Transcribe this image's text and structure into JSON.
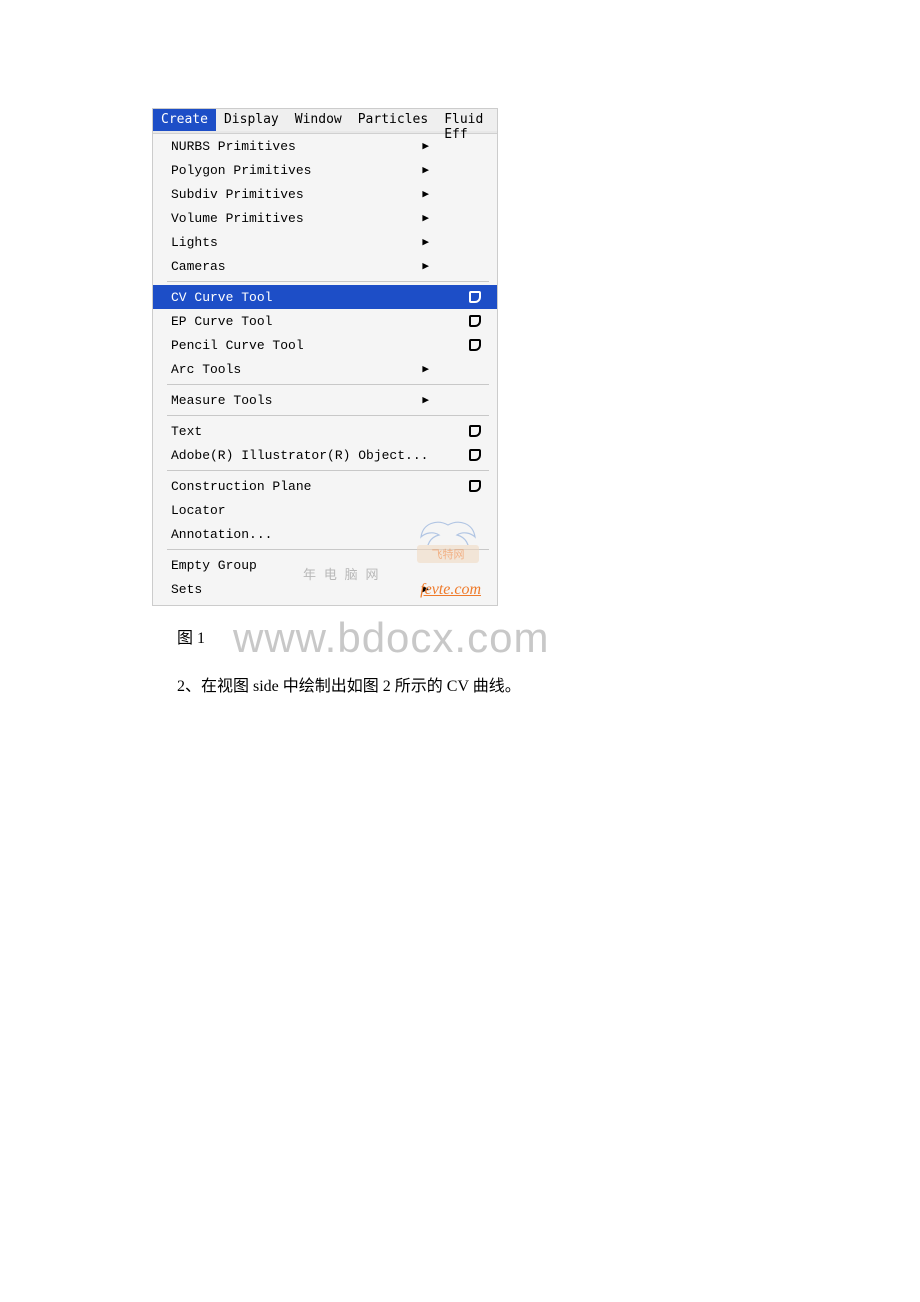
{
  "menubar": {
    "items": [
      "Create",
      "Display",
      "Window",
      "Particles",
      "Fluid Eff"
    ],
    "activeIndex": 0
  },
  "menuGroups": [
    [
      {
        "label": "NURBS Primitives",
        "submenu": true,
        "options": false
      },
      {
        "label": "Polygon Primitives",
        "submenu": true,
        "options": false
      },
      {
        "label": "Subdiv Primitives",
        "submenu": true,
        "options": false
      },
      {
        "label": "Volume Primitives",
        "submenu": true,
        "options": false
      },
      {
        "label": "Lights",
        "submenu": true,
        "options": false
      },
      {
        "label": "Cameras",
        "submenu": true,
        "options": false
      }
    ],
    [
      {
        "label": "CV Curve Tool",
        "submenu": false,
        "options": true,
        "highlighted": true
      },
      {
        "label": "EP Curve Tool",
        "submenu": false,
        "options": true
      },
      {
        "label": "Pencil Curve Tool",
        "submenu": false,
        "options": true
      },
      {
        "label": "Arc Tools",
        "submenu": true,
        "options": false
      }
    ],
    [
      {
        "label": "Measure Tools",
        "submenu": true,
        "options": false
      }
    ],
    [
      {
        "label": "Text",
        "submenu": false,
        "options": true
      },
      {
        "label": "Adobe(R) Illustrator(R) Object...",
        "submenu": false,
        "options": true
      }
    ],
    [
      {
        "label": "Construction Plane",
        "submenu": false,
        "options": true
      },
      {
        "label": "Locator",
        "submenu": false,
        "options": false
      },
      {
        "label": "Annotation...",
        "submenu": false,
        "options": false
      }
    ],
    [
      {
        "label": "Empty Group",
        "submenu": false,
        "options": false
      },
      {
        "label": "Sets",
        "submenu": true,
        "options": false
      }
    ]
  ],
  "watermarks": {
    "logoBadge": "飞特网",
    "smallText": "年 电 脑 网",
    "fevte": "fevte.com",
    "big": "www.bdocx.com"
  },
  "captions": {
    "fig1": "图 1",
    "bodyText": "2、在视图 side 中绘制出如图 2 所示的 CV 曲线。"
  }
}
